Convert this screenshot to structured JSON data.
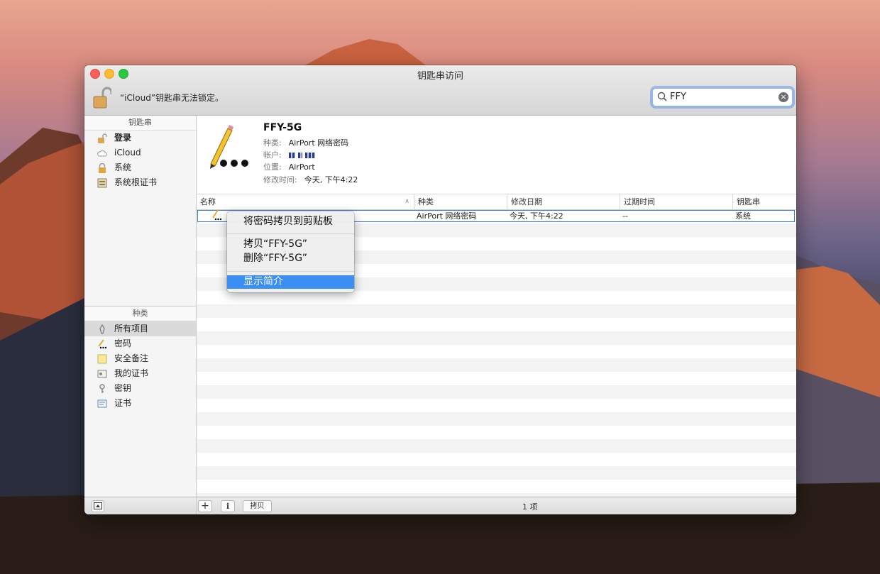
{
  "window": {
    "title": "钥匙串访问"
  },
  "toolbar": {
    "lock_message": "“iCloud”钥匙串无法锁定。",
    "search_value": "FFY"
  },
  "sidebar": {
    "keychains_header": "钥匙串",
    "keychains": [
      {
        "label": "登录",
        "icon": "lock-open-icon"
      },
      {
        "label": "iCloud",
        "icon": "cloud-icon"
      },
      {
        "label": "系统",
        "icon": "lock-icon"
      },
      {
        "label": "系统根证书",
        "icon": "certificate-cabinet-icon"
      }
    ],
    "category_header": "种类",
    "categories": [
      {
        "label": "所有项目",
        "icon": "all-items-icon"
      },
      {
        "label": "密码",
        "icon": "password-icon"
      },
      {
        "label": "安全备注",
        "icon": "secure-note-icon"
      },
      {
        "label": "我的证书",
        "icon": "my-certificate-icon"
      },
      {
        "label": "密钥",
        "icon": "key-icon"
      },
      {
        "label": "证书",
        "icon": "certificate-icon"
      }
    ]
  },
  "details": {
    "name": "FFY-5G",
    "kind_label": "种类:",
    "kind_value": "AirPort 网络密码",
    "account_label": "帐户:",
    "where_label": "位置:",
    "where_value": "AirPort",
    "modified_label": "修改时间:",
    "modified_value": "今天, 下午4:22"
  },
  "table": {
    "columns": [
      "名称",
      "种类",
      "修改日期",
      "过期时间",
      "钥匙串"
    ],
    "rows": [
      {
        "name": "FFY-5G",
        "kind": "AirPort 网络密码",
        "modified": "今天, 下午4:22",
        "expires": "--",
        "keychain": "系统"
      }
    ]
  },
  "context_menu": {
    "items": [
      "将密码拷贝到剪贴板",
      "拷贝“FFY-5G”",
      "删除“FFY-5G”",
      "显示简介"
    ],
    "highlighted": "显示简介"
  },
  "bottom": {
    "copy_label": "拷贝",
    "item_count": "1 项"
  },
  "colors": {
    "accent": "#3b8ef3",
    "selection_border": "#3a7bd5"
  }
}
